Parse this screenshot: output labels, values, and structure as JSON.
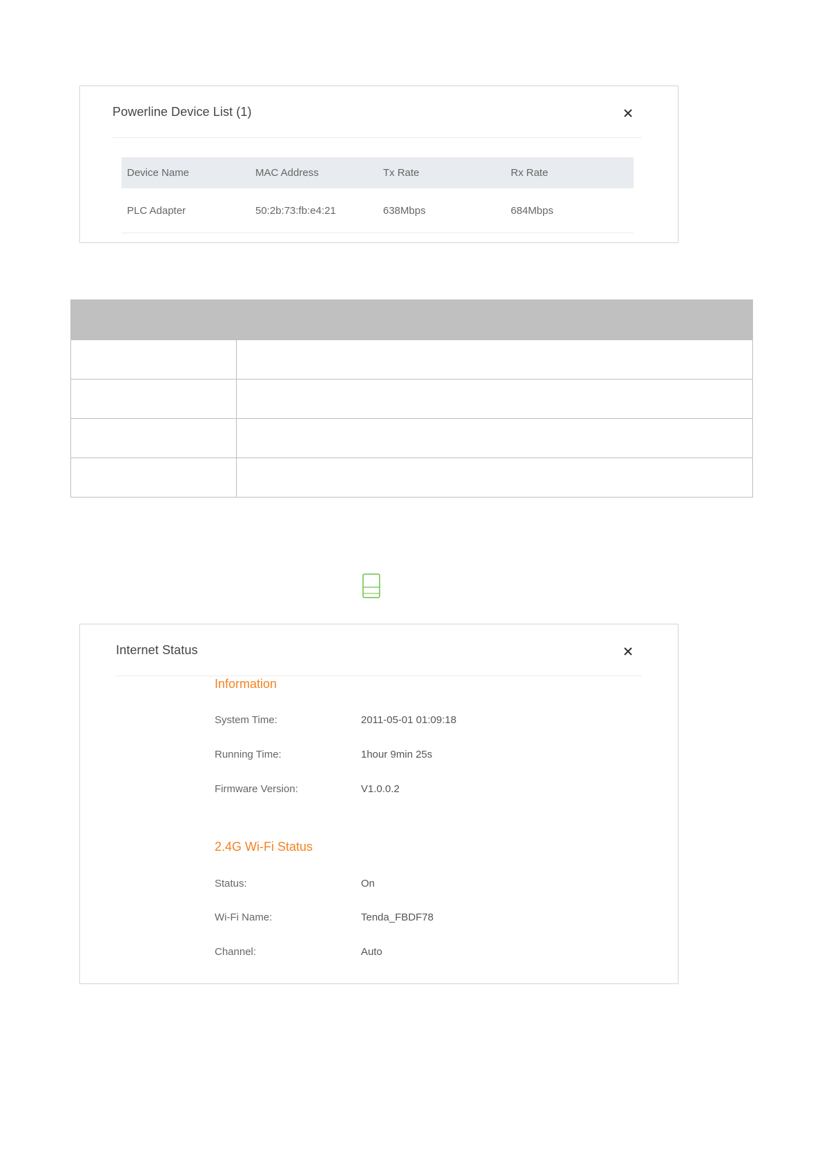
{
  "powerline_dialog": {
    "title": "Powerline Device List (1)",
    "close_label": "×",
    "columns": [
      "Device Name",
      "MAC Address",
      "Tx Rate",
      "Rx Rate"
    ],
    "rows": [
      [
        "PLC Adapter",
        "50:2b:73:fb:e4:21",
        "638Mbps",
        "684Mbps"
      ]
    ]
  },
  "status_dialog": {
    "title": "Internet Status",
    "sections": [
      {
        "title": "Information",
        "rows": [
          {
            "label": "System Time:",
            "value": "2011-05-01 01:09:18"
          },
          {
            "label": "Running Time:",
            "value": "1hour 9min 25s"
          },
          {
            "label": "Firmware Version:",
            "value": "V1.0.0.2"
          }
        ]
      },
      {
        "title": "2.4G Wi-Fi Status",
        "rows": [
          {
            "label": "Status:",
            "value": "On"
          },
          {
            "label": "Wi-Fi Name:",
            "value": "Tenda_FBDF78"
          },
          {
            "label": "Channel:",
            "value": "Auto"
          }
        ]
      }
    ]
  },
  "colors": {
    "section_title": "#f5821f",
    "table_header": "#e8ebef",
    "grid_header": "#c0c0c0",
    "device_icon": "#6cc04a"
  },
  "icons": {
    "close": "close-icon",
    "device": "powerline-device-icon",
    "scroll_up": "scroll-up-arrow-icon",
    "scroll_down": "scroll-down-arrow-icon"
  }
}
